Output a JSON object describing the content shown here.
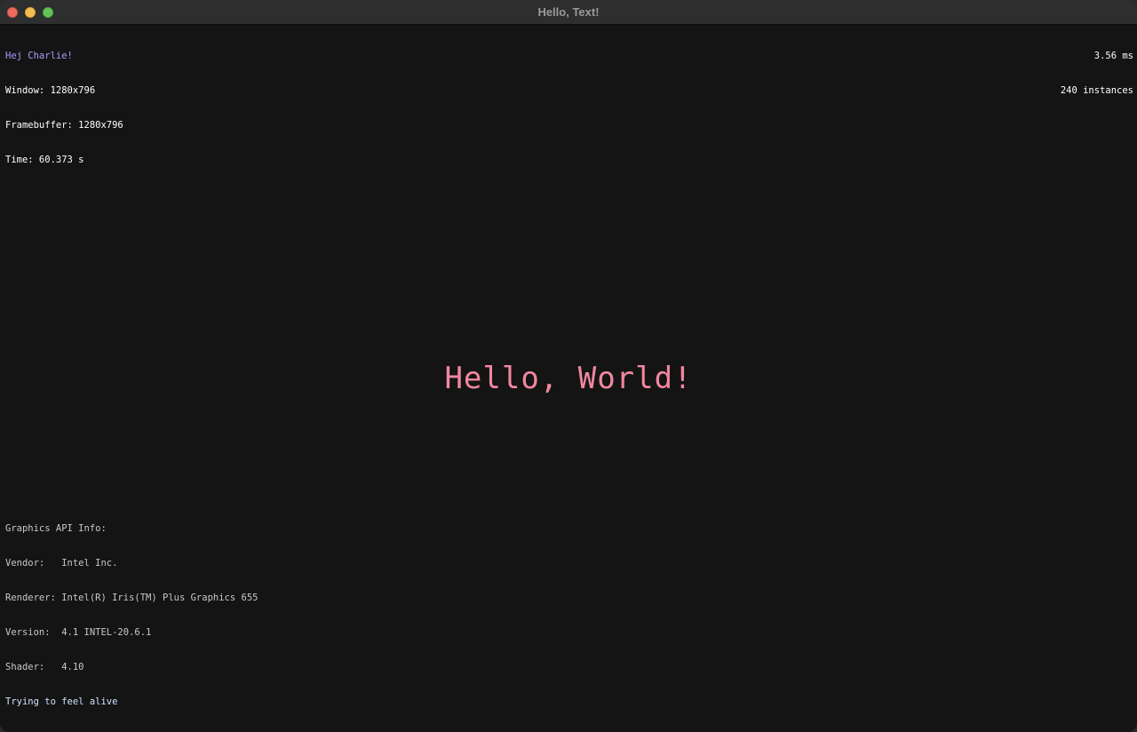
{
  "window": {
    "title": "Hello, Text!"
  },
  "overlay_top_left": {
    "greeting": "Hej Charlie!",
    "window_size": "Window: 1280x796",
    "framebuffer_size": "Framebuffer: 1280x796",
    "time": "Time: 60.373 s"
  },
  "overlay_top_right": {
    "frame_time": "3.56 ms",
    "instances": "240 instances"
  },
  "center": {
    "text": "Hello, World!"
  },
  "graphics_info": {
    "header": "Graphics API Info:",
    "vendor": "Vendor:   Intel Inc.",
    "renderer": "Renderer: Intel(R) Iris(TM) Plus Graphics 655",
    "version": "Version:  4.1 INTEL-20.6.1",
    "shader": "Shader:   4.10"
  },
  "status": {
    "message": "Trying to feel alive"
  },
  "colors": {
    "background": "#141414",
    "greeting": "#a99cff",
    "hello_text": "#f2879f",
    "status_text": "#cfe3ff"
  }
}
